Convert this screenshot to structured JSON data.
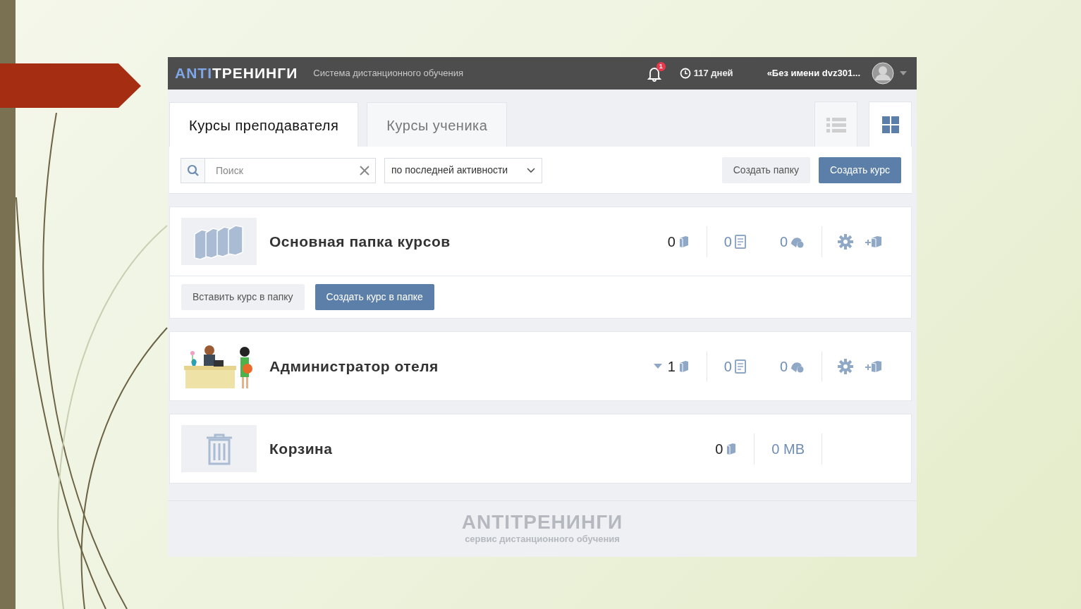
{
  "header": {
    "logo": {
      "prefix": "ANTI",
      "main": "ТРЕНИНГИ"
    },
    "subtitle": "Система дистанционного обучения",
    "notifications": "1",
    "days": "117 дней",
    "user": "«Без имени dvz301..."
  },
  "tabs": [
    {
      "label": "Курсы преподавателя",
      "selected": true
    },
    {
      "label": "Курсы ученика",
      "selected": false
    }
  ],
  "view_toggle": [
    {
      "kind": "list",
      "selected": false
    },
    {
      "kind": "grid",
      "selected": true
    }
  ],
  "toolbar": {
    "search": {
      "placeholder": "Поиск"
    },
    "sort": "по последней активности",
    "buttons": [
      {
        "label": "Создать папку",
        "kind": "secondary"
      },
      {
        "label": "Создать курс",
        "kind": "primary"
      }
    ]
  },
  "items": [
    {
      "kind": "folder",
      "title": "Основная папка курсов",
      "toggle": false,
      "stats": [
        {
          "kind": "courses",
          "value": "0"
        },
        {
          "kind": "documents",
          "value": "0"
        },
        {
          "kind": "students",
          "value": "0"
        }
      ],
      "actions": true,
      "buttons": [
        {
          "label": "Вставить курс в папку",
          "kind": "secondary"
        },
        {
          "label": "Создать курс в папке",
          "kind": "primary"
        }
      ]
    },
    {
      "kind": "course",
      "title": "Администратор отеля",
      "toggle": true,
      "stats": [
        {
          "kind": "courses",
          "value": "1"
        },
        {
          "kind": "documents",
          "value": "0"
        },
        {
          "kind": "students",
          "value": "0"
        }
      ],
      "actions": true
    },
    {
      "kind": "trash",
      "title": "Корзина",
      "toggle": false,
      "stats": [
        {
          "kind": "courses",
          "value": "0"
        },
        {
          "kind": "size",
          "value": "0 MB"
        }
      ],
      "actions": false
    }
  ],
  "footer": {
    "logo": "ANTIТРЕНИНГИ",
    "tagline": "сервис дистанционного обучения"
  }
}
